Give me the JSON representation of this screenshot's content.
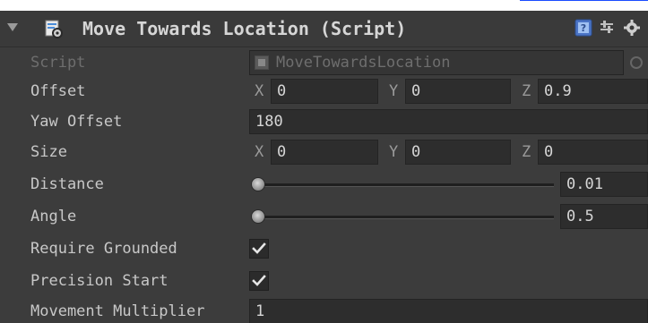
{
  "component": {
    "title": "Move Towards Location (Script)",
    "icons": {
      "fold": "fold-arrow-icon",
      "enable": "enable-checkbox",
      "script": "script-icon",
      "help": "help-icon",
      "preset": "preset-icon",
      "gear": "gear-icon"
    }
  },
  "fields": {
    "script": {
      "label": "Script",
      "value": "MoveTowardsLocation"
    },
    "offset": {
      "label": "Offset",
      "x": "0",
      "y": "0",
      "z": "0.9"
    },
    "yaw_offset": {
      "label": "Yaw Offset",
      "value": "180"
    },
    "size": {
      "label": "Size",
      "x": "0",
      "y": "0",
      "z": "0"
    },
    "distance": {
      "label": "Distance",
      "value": "0.01"
    },
    "angle": {
      "label": "Angle",
      "value": "0.5"
    },
    "require_grounded": {
      "label": "Require Grounded",
      "checked": true
    },
    "precision_start": {
      "label": "Precision Start",
      "checked": true
    },
    "movement_multiplier": {
      "label": "Movement Multiplier",
      "value": "1"
    }
  },
  "axes": {
    "x": "X",
    "y": "Y",
    "z": "Z"
  },
  "colors": {
    "panel_bg": "#3c3c3c",
    "field_bg": "#2d2d2d",
    "text": "#c8c8c8",
    "dim_text": "#6e6e6e"
  }
}
